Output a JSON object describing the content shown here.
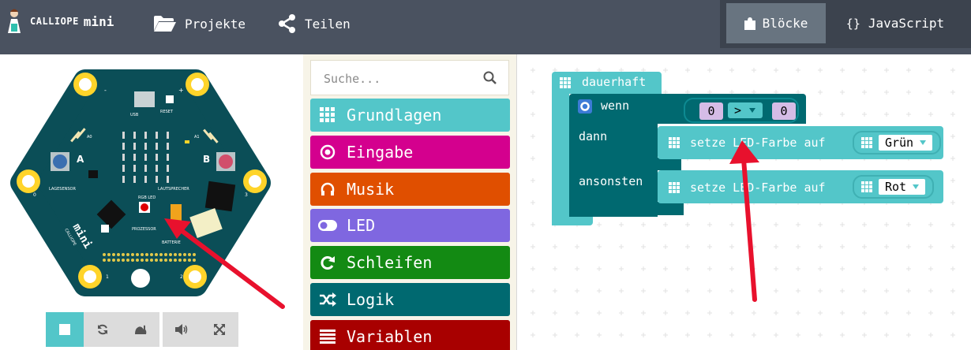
{
  "app": {
    "brand_small": "CALLIOPE",
    "brand_big": "mini"
  },
  "nav": {
    "projects": "Projekte",
    "share": "Teilen"
  },
  "editor_toggle": {
    "blocks": "Blöcke",
    "javascript": "JavaScript",
    "js_braces": "{}"
  },
  "simulator": {
    "board_labels": {
      "usb": "USB",
      "reset": "RESET",
      "a": "A",
      "b": "B",
      "a0": "A0",
      "a1": "A1",
      "lagesensor": "LAGESENSOR",
      "lautsprecher": "LAUTSPRECHER",
      "rgb_led": "RGB LED",
      "prozessor": "PROZESSOR",
      "batterie": "BATTERIE",
      "brand": "mini",
      "brand_small": "CALLIOPE",
      "pin0": "0",
      "pin1": "1",
      "pin2": "2",
      "pin3": "3",
      "minus": "-",
      "plus": "+"
    }
  },
  "toolbox": {
    "search_placeholder": "Suche...",
    "categories": [
      {
        "label": "Grundlagen",
        "color": "#53c6c9",
        "icon": "grid-icon"
      },
      {
        "label": "Eingabe",
        "color": "#d4008e",
        "icon": "target-icon"
      },
      {
        "label": "Musik",
        "color": "#e04f00",
        "icon": "headphones-icon"
      },
      {
        "label": "LED",
        "color": "#7f67e0",
        "icon": "toggle-icon"
      },
      {
        "label": "Schleifen",
        "color": "#138a13",
        "icon": "loop-icon"
      },
      {
        "label": "Logik",
        "color": "#006970",
        "icon": "shuffle-icon"
      },
      {
        "label": "Variablen",
        "color": "#a80000",
        "icon": "list-icon"
      }
    ]
  },
  "workspace": {
    "forever_label": "dauerhaft",
    "if_label": "wenn",
    "then_label": "dann",
    "else_label": "ansonsten",
    "compare_left": "0",
    "compare_op": ">",
    "compare_right": "0",
    "set_led_text": "setze LED-Farbe auf",
    "color_then": "Grün",
    "color_else": "Rot"
  }
}
